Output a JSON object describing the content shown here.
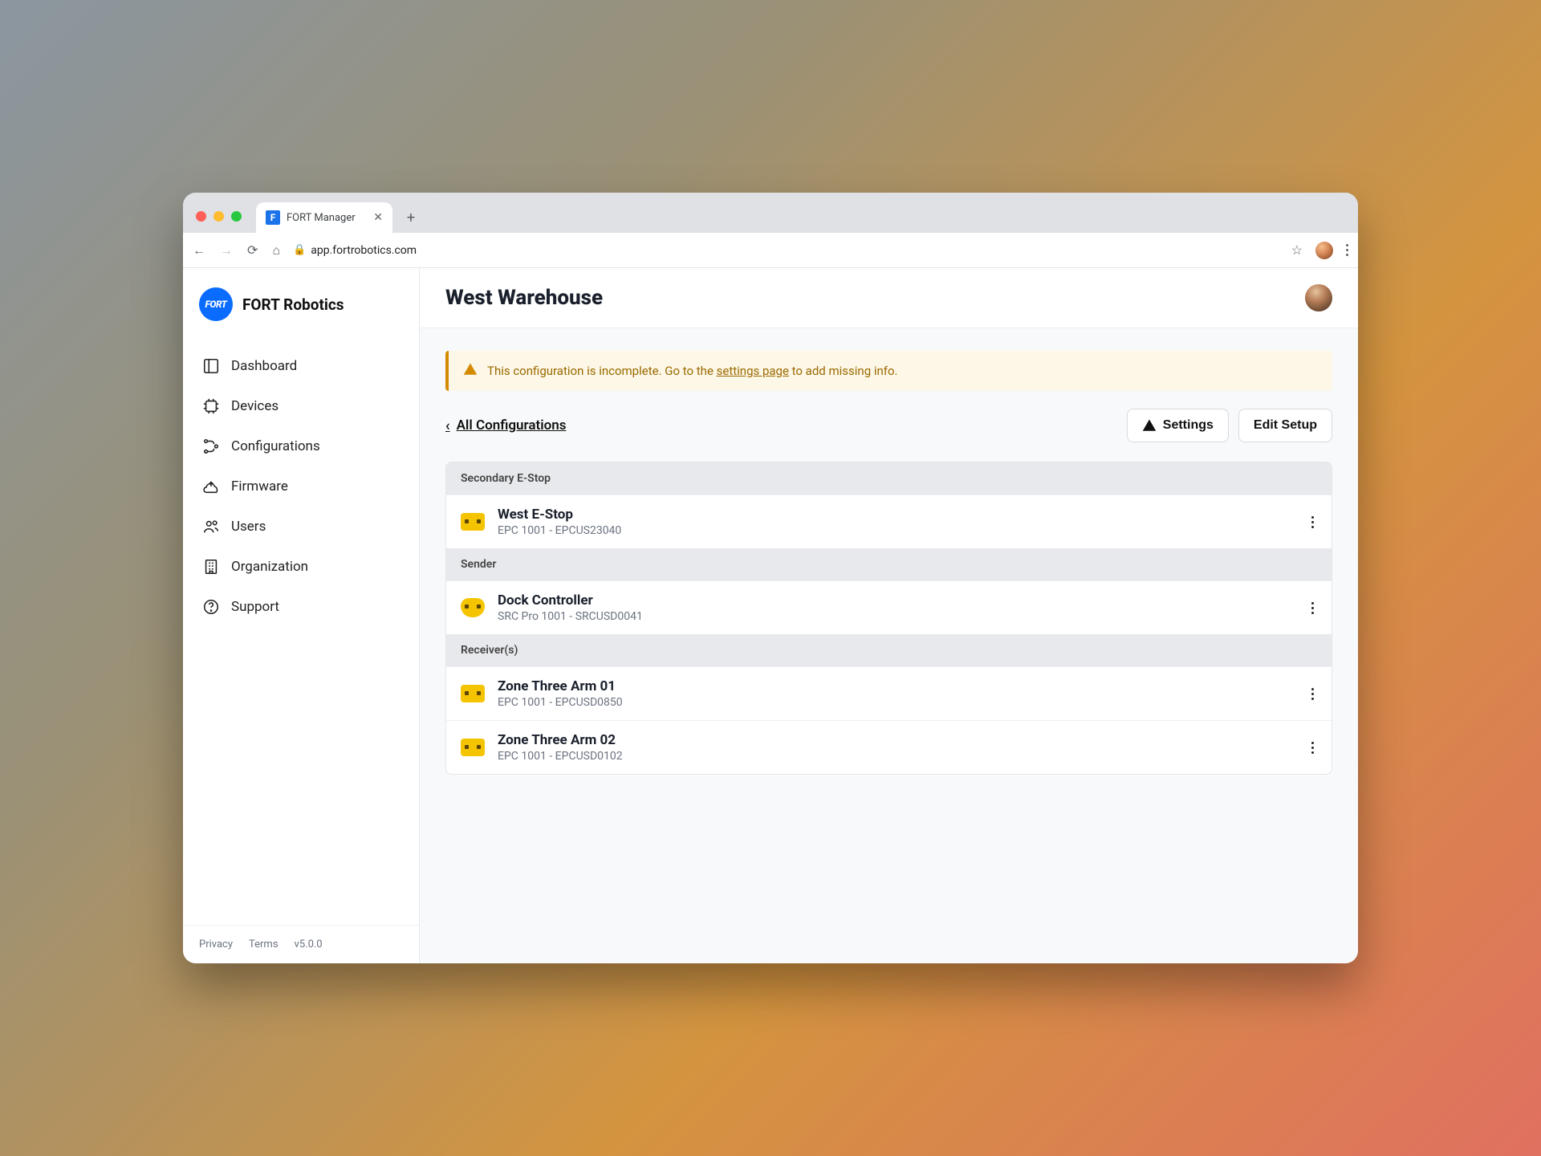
{
  "browser": {
    "tab_title": "FORT Manager",
    "url": "app.fortrobotics.com"
  },
  "brand": {
    "logo_text": "FORT",
    "name": "FORT Robotics"
  },
  "sidebar": {
    "items": [
      {
        "label": "Dashboard"
      },
      {
        "label": "Devices"
      },
      {
        "label": "Configurations"
      },
      {
        "label": "Firmware"
      },
      {
        "label": "Users"
      },
      {
        "label": "Organization"
      },
      {
        "label": "Support"
      }
    ],
    "footer": {
      "privacy": "Privacy",
      "terms": "Terms",
      "version": "v5.0.0"
    }
  },
  "page": {
    "title": "West Warehouse",
    "banner": {
      "pre": "This configuration is incomplete. Go to the ",
      "link": "settings page",
      "post": " to add missing info."
    },
    "back_label": "All Configurations",
    "buttons": {
      "settings": "Settings",
      "edit": "Edit Setup"
    },
    "sections": [
      {
        "heading": "Secondary E-Stop",
        "rows": [
          {
            "name": "West E-Stop",
            "meta": "EPC 1001  -  EPCUS23040",
            "icon": "epc"
          }
        ]
      },
      {
        "heading": "Sender",
        "rows": [
          {
            "name": "Dock Controller",
            "meta": "SRC Pro 1001  -  SRCUSD0041",
            "icon": "controller"
          }
        ]
      },
      {
        "heading": "Receiver(s)",
        "rows": [
          {
            "name": "Zone Three Arm 01",
            "meta": "EPC 1001  -  EPCUSD0850",
            "icon": "epc"
          },
          {
            "name": "Zone Three Arm 02",
            "meta": "EPC 1001  -  EPCUSD0102",
            "icon": "epc"
          }
        ]
      }
    ]
  }
}
